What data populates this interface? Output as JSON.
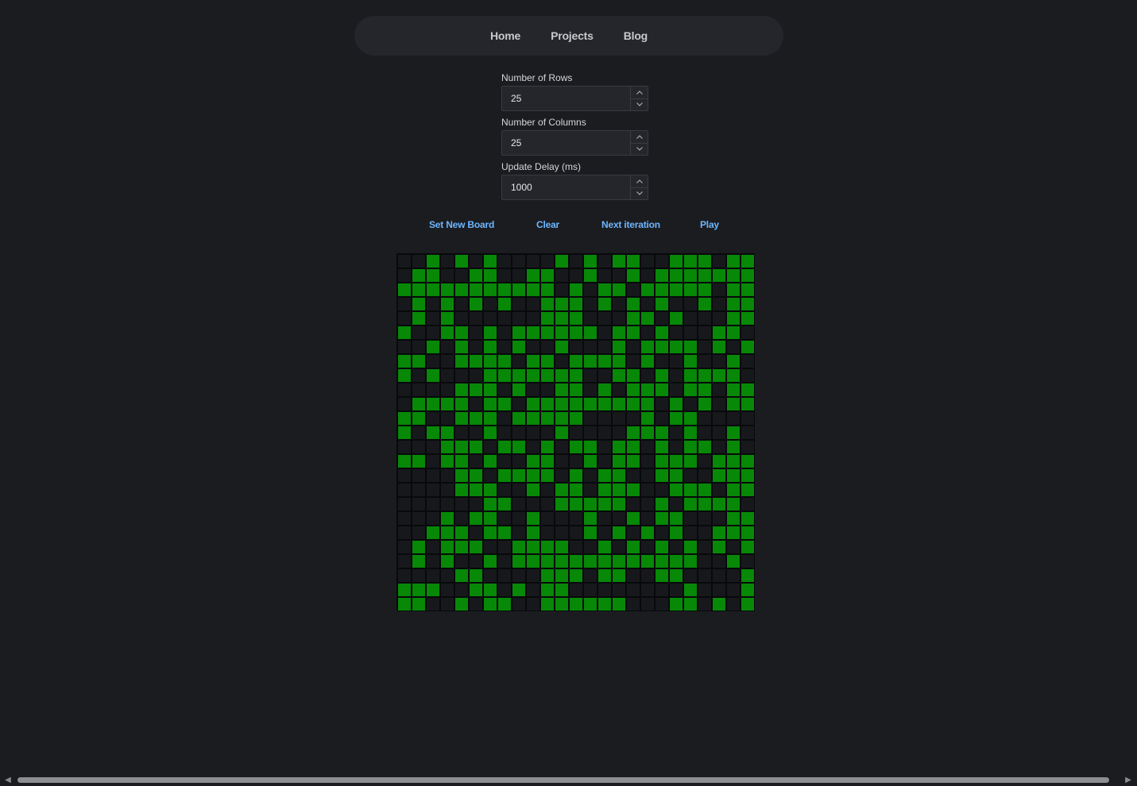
{
  "nav": {
    "home": "Home",
    "projects": "Projects",
    "blog": "Blog"
  },
  "form": {
    "rows_label": "Number of Rows",
    "rows_value": "25",
    "cols_label": "Number of Columns",
    "cols_value": "25",
    "delay_label": "Update Delay (ms)",
    "delay_value": "1000"
  },
  "actions": {
    "set_new_board": "Set New Board",
    "clear": "Clear",
    "next_iteration": "Next iteration",
    "play": "Play"
  },
  "board": {
    "rows": 25,
    "cols": 25,
    "alive_color": "#078807",
    "dead_color": "#17181c",
    "cells": [
      "0010101000010101100111011",
      "0110011001100100101111111",
      "1111111111101011011111011",
      "0101010100111010101001011",
      "0101000000111000110100011",
      "1001101011111101101000110",
      "0010101010010001011110101",
      "1100111101101111010010010",
      "1010001111111001101011110",
      "0000111010011010111011011",
      "0111101101111111110101011",
      "1100111011111000010110000",
      "1011001000010000111010010",
      "0001110110101101101011010",
      "1101101001100101101110111",
      "0000110111101011001100111",
      "0000111001011011100111011",
      "0000001100011111001011110",
      "0001011001000100101100011",
      "0011101101000101010100111",
      "0101110011110010101010101",
      "0101001011111111111110010",
      "0000110000111011001100001",
      "1110011010110000000010001",
      "1100101100111111000110101"
    ]
  }
}
